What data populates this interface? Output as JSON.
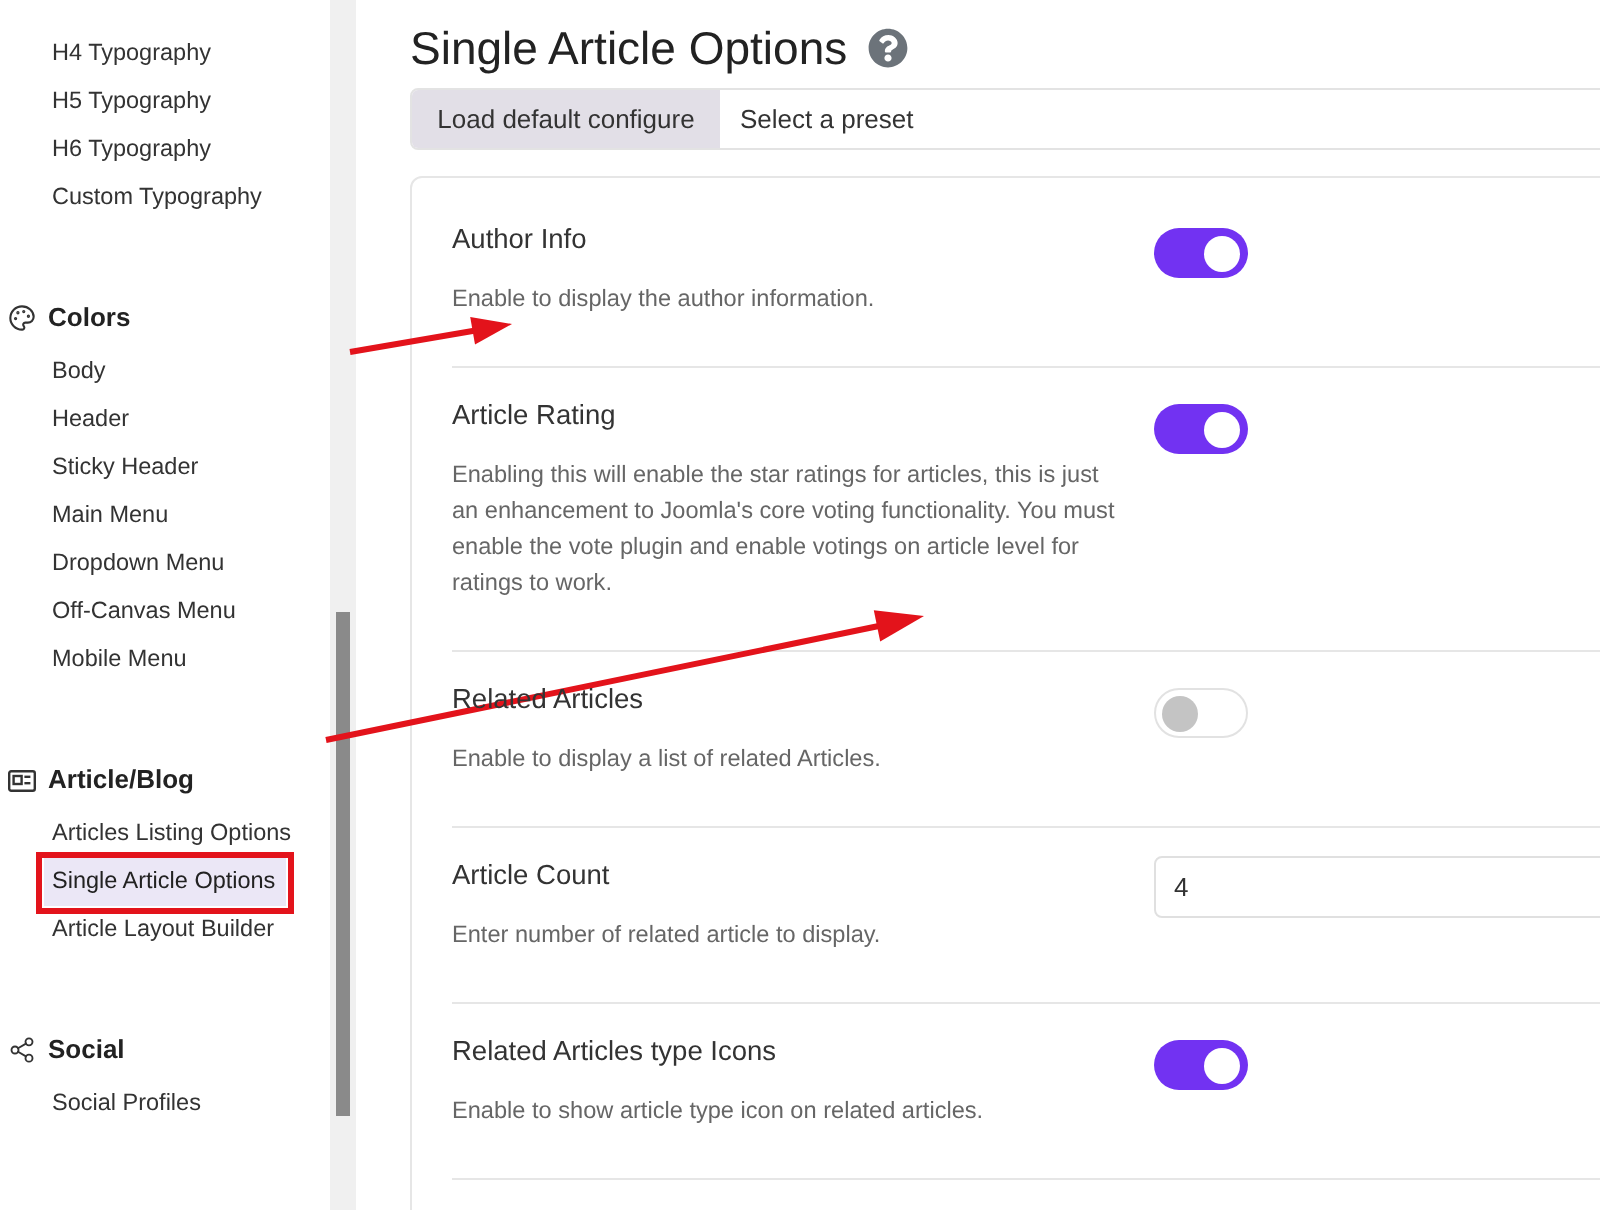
{
  "sidebar": {
    "items": [
      {
        "label": "H4 Typography",
        "selected": false
      },
      {
        "label": "H5 Typography",
        "selected": false
      },
      {
        "label": "H6 Typography",
        "selected": false
      },
      {
        "label": "Custom Typography",
        "selected": false
      }
    ],
    "sections": [
      {
        "heading": "Colors",
        "items": [
          {
            "label": "Body",
            "selected": false
          },
          {
            "label": "Header",
            "selected": false
          },
          {
            "label": "Sticky Header",
            "selected": false
          },
          {
            "label": "Main Menu",
            "selected": false
          },
          {
            "label": "Dropdown Menu",
            "selected": false
          },
          {
            "label": "Off-Canvas Menu",
            "selected": false
          },
          {
            "label": "Mobile Menu",
            "selected": false
          }
        ]
      },
      {
        "heading": "Article/Blog",
        "items": [
          {
            "label": "Articles Listing Options",
            "selected": false
          },
          {
            "label": "Single Article Options",
            "selected": true
          },
          {
            "label": "Article Layout Builder",
            "selected": false
          }
        ]
      },
      {
        "heading": "Social",
        "items": [
          {
            "label": "Social Profiles",
            "selected": false
          }
        ]
      }
    ]
  },
  "page": {
    "title": "Single Article Options"
  },
  "toolbar": {
    "button": "Load default configure",
    "preset_select": {
      "value": "Select a preset"
    }
  },
  "settings": [
    {
      "kind": "toggle",
      "label": "Author Info",
      "description": "Enable to display the author information.",
      "on": true
    },
    {
      "kind": "toggle",
      "label": "Article Rating",
      "description": "Enabling this will enable the star ratings for articles, this is just an enhancement to Joomla's core voting functionality. You must enable the vote plugin and enable votings on article level for ratings to work.",
      "on": true
    },
    {
      "kind": "toggle",
      "label": "Related Articles",
      "description": "Enable to display a list of related Articles.",
      "on": false
    },
    {
      "kind": "number",
      "label": "Article Count",
      "description": "Enter number of related article to display.",
      "value": "4"
    },
    {
      "kind": "toggle",
      "label": "Related Articles type Icons",
      "description": "Enable to show article type icon on related articles.",
      "on": true
    }
  ]
}
